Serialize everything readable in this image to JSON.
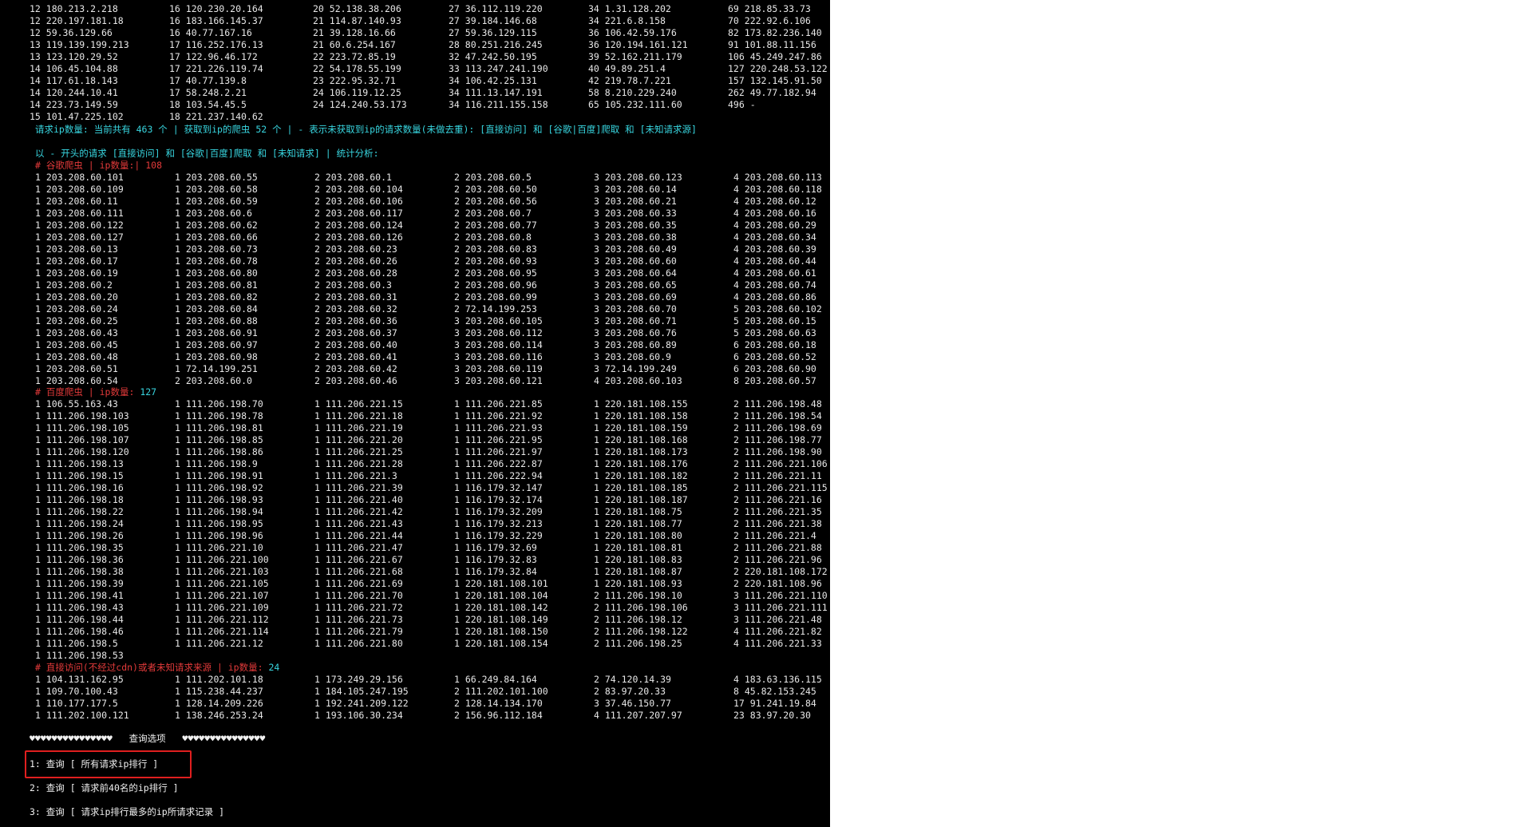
{
  "colors": {
    "background": "#000000",
    "text": "#e8e8e8",
    "cyan": "#38d6e0",
    "red": "#e33a3a",
    "highlight": "#e01f1f"
  },
  "top_table": {
    "rows": [
      [
        "12 180.213.2.218",
        "16 120.230.20.164",
        "20 52.138.38.206",
        "27 36.112.119.220",
        "34 1.31.128.202",
        "69 218.85.33.73"
      ],
      [
        "12 220.197.181.18",
        "16 183.166.145.37",
        "21 114.87.140.93",
        "27 39.184.146.68",
        "34 221.6.8.158",
        "70 222.92.6.106"
      ],
      [
        "12 59.36.129.66",
        "16 40.77.167.16",
        "21 39.128.16.66",
        "27 59.36.129.115",
        "36 106.42.59.176",
        "82 173.82.236.140"
      ],
      [
        "13 119.139.199.213",
        "17 116.252.176.13",
        "21 60.6.254.167",
        "28 80.251.216.245",
        "36 120.194.161.121",
        "91 101.88.11.156"
      ],
      [
        "13 123.120.29.52",
        "17 122.96.46.172",
        "22 223.72.85.19",
        "32 47.242.50.195",
        "39 52.162.211.179",
        "106 45.249.247.86"
      ],
      [
        "14 106.45.104.88",
        "17 221.226.119.74",
        "22 54.178.55.199",
        "33 113.247.241.190",
        "40 49.89.251.4",
        "127 220.248.53.122"
      ],
      [
        "14 117.61.18.143",
        "17 40.77.139.8",
        "23 222.95.32.71",
        "34 106.42.25.131",
        "42 219.78.7.221",
        "157 132.145.91.50"
      ],
      [
        "14 120.244.10.41",
        "17 58.248.2.21",
        "24 106.119.12.25",
        "34 111.13.147.191",
        "58 8.210.229.240",
        "262 49.77.182.94"
      ],
      [
        "14 223.73.149.59",
        "18 103.54.45.5",
        "24 124.240.53.173",
        "34 116.211.155.158",
        "65 105.232.111.60",
        "496 -"
      ],
      [
        "15 101.47.225.102",
        "18 221.237.140.62",
        "",
        "",
        "",
        ""
      ]
    ]
  },
  "summary_line": "请求ip数量: 当前共有 463 个 | 获取到ip的爬虫 52 个 | - 表示未获取到ip的请求数量(未做去重): [直接访问] 和 [谷歌|百度]爬取 和 [未知请求源]",
  "analysis_line": "以 - 开头的请求 [直接访问] 和 [谷歌|百度]爬取 和 [未知请求] | 统计分析:",
  "google_header": "# 谷歌爬虫 | ip数量:| 108",
  "google_rows": [
    [
      "1 203.208.60.101",
      "1 203.208.60.55",
      "2 203.208.60.1",
      "2 203.208.60.5",
      "3 203.208.60.123",
      "4 203.208.60.113"
    ],
    [
      "1 203.208.60.109",
      "1 203.208.60.58",
      "2 203.208.60.104",
      "2 203.208.60.50",
      "3 203.208.60.14",
      "4 203.208.60.118"
    ],
    [
      "1 203.208.60.11",
      "1 203.208.60.59",
      "2 203.208.60.106",
      "2 203.208.60.56",
      "3 203.208.60.21",
      "4 203.208.60.12"
    ],
    [
      "1 203.208.60.111",
      "1 203.208.60.6",
      "2 203.208.60.117",
      "2 203.208.60.7",
      "3 203.208.60.33",
      "4 203.208.60.16"
    ],
    [
      "1 203.208.60.122",
      "1 203.208.60.62",
      "2 203.208.60.124",
      "2 203.208.60.77",
      "3 203.208.60.35",
      "4 203.208.60.29"
    ],
    [
      "1 203.208.60.127",
      "1 203.208.60.66",
      "2 203.208.60.126",
      "2 203.208.60.8",
      "3 203.208.60.38",
      "4 203.208.60.34"
    ],
    [
      "1 203.208.60.13",
      "1 203.208.60.73",
      "2 203.208.60.23",
      "2 203.208.60.83",
      "3 203.208.60.49",
      "4 203.208.60.39"
    ],
    [
      "1 203.208.60.17",
      "1 203.208.60.78",
      "2 203.208.60.26",
      "2 203.208.60.93",
      "3 203.208.60.60",
      "4 203.208.60.44"
    ],
    [
      "1 203.208.60.19",
      "1 203.208.60.80",
      "2 203.208.60.28",
      "2 203.208.60.95",
      "3 203.208.60.64",
      "4 203.208.60.61"
    ],
    [
      "1 203.208.60.2",
      "1 203.208.60.81",
      "2 203.208.60.3",
      "2 203.208.60.96",
      "3 203.208.60.65",
      "4 203.208.60.74"
    ],
    [
      "1 203.208.60.20",
      "1 203.208.60.82",
      "2 203.208.60.31",
      "2 203.208.60.99",
      "3 203.208.60.69",
      "4 203.208.60.86"
    ],
    [
      "1 203.208.60.24",
      "1 203.208.60.84",
      "2 203.208.60.32",
      "2 72.14.199.253",
      "3 203.208.60.70",
      "5 203.208.60.102"
    ],
    [
      "1 203.208.60.25",
      "1 203.208.60.88",
      "2 203.208.60.36",
      "3 203.208.60.105",
      "3 203.208.60.71",
      "5 203.208.60.15"
    ],
    [
      "1 203.208.60.43",
      "1 203.208.60.91",
      "2 203.208.60.37",
      "3 203.208.60.112",
      "3 203.208.60.76",
      "5 203.208.60.63"
    ],
    [
      "1 203.208.60.45",
      "1 203.208.60.97",
      "2 203.208.60.40",
      "3 203.208.60.114",
      "3 203.208.60.89",
      "6 203.208.60.18"
    ],
    [
      "1 203.208.60.48",
      "1 203.208.60.98",
      "2 203.208.60.41",
      "3 203.208.60.116",
      "3 203.208.60.9",
      "6 203.208.60.52"
    ],
    [
      "1 203.208.60.51",
      "1 72.14.199.251",
      "2 203.208.60.42",
      "3 203.208.60.119",
      "3 72.14.199.249",
      "6 203.208.60.90"
    ],
    [
      "1 203.208.60.54",
      "2 203.208.60.0",
      "2 203.208.60.46",
      "3 203.208.60.121",
      "4 203.208.60.103",
      "8 203.208.60.57"
    ]
  ],
  "baidu_header_label": "# 百度爬虫 | ip数量:",
  "baidu_header_count": " 127",
  "baidu_rows": [
    [
      "1 106.55.163.43",
      "1 111.206.198.70",
      "1 111.206.221.15",
      "1 111.206.221.85",
      "1 220.181.108.155",
      "2 111.206.198.48"
    ],
    [
      "1 111.206.198.103",
      "1 111.206.198.78",
      "1 111.206.221.18",
      "1 111.206.221.92",
      "1 220.181.108.158",
      "2 111.206.198.54"
    ],
    [
      "1 111.206.198.105",
      "1 111.206.198.81",
      "1 111.206.221.19",
      "1 111.206.221.93",
      "1 220.181.108.159",
      "2 111.206.198.69"
    ],
    [
      "1 111.206.198.107",
      "1 111.206.198.85",
      "1 111.206.221.20",
      "1 111.206.221.95",
      "1 220.181.108.168",
      "2 111.206.198.77"
    ],
    [
      "1 111.206.198.120",
      "1 111.206.198.86",
      "1 111.206.221.25",
      "1 111.206.221.97",
      "1 220.181.108.173",
      "2 111.206.198.90"
    ],
    [
      "1 111.206.198.13",
      "1 111.206.198.9",
      "1 111.206.221.28",
      "1 111.206.222.87",
      "1 220.181.108.176",
      "2 111.206.221.106"
    ],
    [
      "1 111.206.198.15",
      "1 111.206.198.91",
      "1 111.206.221.3",
      "1 111.206.222.94",
      "1 220.181.108.182",
      "2 111.206.221.11"
    ],
    [
      "1 111.206.198.16",
      "1 111.206.198.92",
      "1 111.206.221.39",
      "1 116.179.32.147",
      "1 220.181.108.185",
      "2 111.206.221.115"
    ],
    [
      "1 111.206.198.18",
      "1 111.206.198.93",
      "1 111.206.221.40",
      "1 116.179.32.174",
      "1 220.181.108.187",
      "2 111.206.221.16"
    ],
    [
      "1 111.206.198.22",
      "1 111.206.198.94",
      "1 111.206.221.42",
      "1 116.179.32.209",
      "1 220.181.108.75",
      "2 111.206.221.35"
    ],
    [
      "1 111.206.198.24",
      "1 111.206.198.95",
      "1 111.206.221.43",
      "1 116.179.32.213",
      "1 220.181.108.77",
      "2 111.206.221.38"
    ],
    [
      "1 111.206.198.26",
      "1 111.206.198.96",
      "1 111.206.221.44",
      "1 116.179.32.229",
      "1 220.181.108.80",
      "2 111.206.221.4"
    ],
    [
      "1 111.206.198.35",
      "1 111.206.221.10",
      "1 111.206.221.47",
      "1 116.179.32.69",
      "1 220.181.108.81",
      "2 111.206.221.88"
    ],
    [
      "1 111.206.198.36",
      "1 111.206.221.100",
      "1 111.206.221.67",
      "1 116.179.32.83",
      "1 220.181.108.83",
      "2 111.206.221.96"
    ],
    [
      "1 111.206.198.38",
      "1 111.206.221.103",
      "1 111.206.221.68",
      "1 116.179.32.84",
      "1 220.181.108.87",
      "2 220.181.108.172"
    ],
    [
      "1 111.206.198.39",
      "1 111.206.221.105",
      "1 111.206.221.69",
      "1 220.181.108.101",
      "1 220.181.108.93",
      "2 220.181.108.96"
    ],
    [
      "1 111.206.198.41",
      "1 111.206.221.107",
      "1 111.206.221.70",
      "1 220.181.108.104",
      "2 111.206.198.10",
      "3 111.206.221.110"
    ],
    [
      "1 111.206.198.43",
      "1 111.206.221.109",
      "1 111.206.221.72",
      "1 220.181.108.142",
      "2 111.206.198.106",
      "3 111.206.221.111"
    ],
    [
      "1 111.206.198.44",
      "1 111.206.221.112",
      "1 111.206.221.73",
      "1 220.181.108.149",
      "2 111.206.198.12",
      "3 111.206.221.48"
    ],
    [
      "1 111.206.198.46",
      "1 111.206.221.114",
      "1 111.206.221.79",
      "1 220.181.108.150",
      "2 111.206.198.122",
      "4 111.206.221.82"
    ],
    [
      "1 111.206.198.5",
      "1 111.206.221.12",
      "1 111.206.221.80",
      "1 220.181.108.154",
      "2 111.206.198.25",
      "4 111.206.221.33"
    ],
    [
      "1 111.206.198.53",
      "",
      "",
      "",
      "",
      ""
    ]
  ],
  "direct_header_label": "# 直接访问(不经过cdn)或者未知请求来源 | ip数量:",
  "direct_header_count": " 24",
  "direct_rows": [
    [
      "1 104.131.162.95",
      "1 111.202.101.18",
      "1 173.249.29.156",
      "1 66.249.84.164",
      "2 74.120.14.39",
      "4 183.63.136.115"
    ],
    [
      "1 109.70.100.43",
      "1 115.238.44.237",
      "1 184.105.247.195",
      "2 111.202.101.100",
      "2 83.97.20.33",
      "8 45.82.153.245"
    ],
    [
      "1 110.177.177.5",
      "1 128.14.209.226",
      "1 192.241.209.122",
      "2 128.14.134.170",
      "3 37.46.150.77",
      "17 91.241.19.84"
    ],
    [
      "1 111.202.100.121",
      "1 138.246.253.24",
      "1 193.106.30.234",
      "2 156.96.112.184",
      "4 111.207.207.97",
      "23 83.97.20.30"
    ]
  ],
  "menu": {
    "title": "♥♥♥♥♥♥♥♥♥♥♥♥♥♥♥   查询选项   ♥♥♥♥♥♥♥♥♥♥♥♥♥♥♥",
    "option1": "1: 查询 [ 所有请求ip排行 ]",
    "option2": "2: 查询 [ 请求前40名的ip排行 ]",
    "option3": "3: 查询 [ 请求ip排行最多的ip所请求记录 ]"
  }
}
